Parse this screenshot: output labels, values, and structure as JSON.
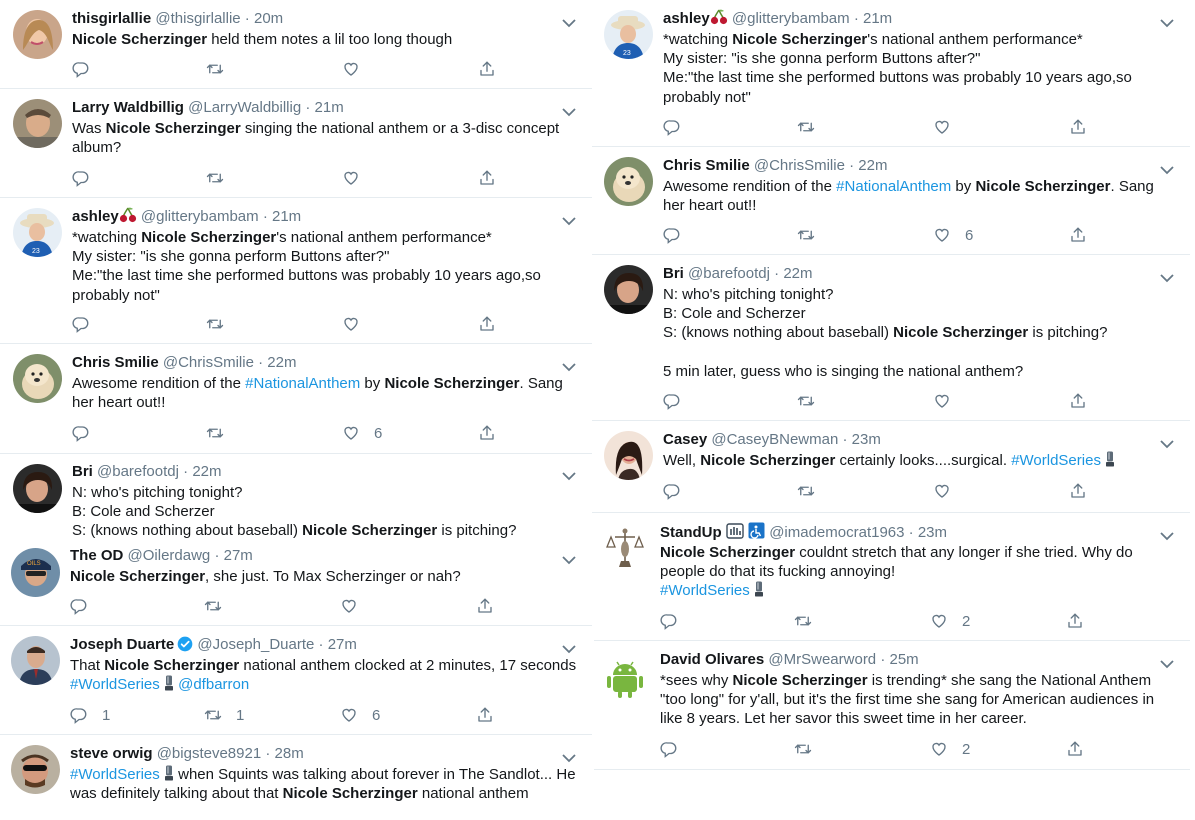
{
  "colors": {
    "text": "#14171a",
    "secondary": "#657786",
    "link": "#1b95e0",
    "divider": "#e6ecf0"
  },
  "left": [
    {
      "name": "thisgirlallie",
      "handle": "@thisgirlallie",
      "time": "20m",
      "lines": [
        [
          {
            "b": "Nicole Scherzinger"
          },
          {
            "t": " held them notes a lil too long though"
          }
        ]
      ],
      "replies": "",
      "retweets": "",
      "likes": ""
    },
    {
      "name": "Larry Waldbillig",
      "handle": "@LarryWaldbillig",
      "time": "21m",
      "lines": [
        [
          {
            "t": "Was "
          },
          {
            "b": "Nicole Scherzinger"
          },
          {
            "t": " singing the national anthem or a 3-disc concept"
          }
        ],
        [
          {
            "t": "album?"
          }
        ]
      ],
      "replies": "",
      "retweets": "",
      "likes": ""
    },
    {
      "name": "ashley",
      "handle": "@glitterybambam",
      "time": "21m",
      "lines": [
        [
          {
            "t": "*watching "
          },
          {
            "b": "Nicole Scherzinger"
          },
          {
            "t": "'s national anthem performance*"
          }
        ],
        [
          {
            "t": "My sister: \"is she gonna perform Buttons after?\""
          }
        ],
        [
          {
            "t": "Me:\"the last time she performed buttons was probably 10 years ago,so"
          }
        ],
        [
          {
            "t": "probably not\""
          }
        ]
      ],
      "replies": "",
      "retweets": "",
      "likes": ""
    },
    {
      "name": "Chris Smilie",
      "handle": "@ChrisSmilie",
      "time": "22m",
      "lines": [
        [
          {
            "t": "Awesome rendition of the "
          },
          {
            "h": "#NationalAnthem"
          },
          {
            "t": " by "
          },
          {
            "b": "Nicole Scherzinger"
          },
          {
            "t": ".  Sang"
          }
        ],
        [
          {
            "t": "her heart out!!"
          }
        ]
      ],
      "replies": "",
      "retweets": "",
      "likes": "6"
    },
    {
      "name": "Bri",
      "handle": "@barefootdj",
      "time": "22m",
      "lines": [
        [
          {
            "t": "N: who's pitching tonight?"
          }
        ],
        [
          {
            "t": "B: Cole and Scherzer"
          }
        ],
        [
          {
            "t": "S: (knows nothing about baseball) "
          },
          {
            "b": "Nicole Scherzinger"
          },
          {
            "t": " is pitching?"
          }
        ]
      ],
      "replies": "",
      "retweets": "",
      "likes": ""
    },
    {
      "name": "The OD",
      "handle": "@Oilerdawg",
      "time": "27m",
      "lines": [
        [
          {
            "b": "Nicole Scherzinger"
          },
          {
            "t": ", she just. To Max Scherzinger or nah?"
          }
        ]
      ],
      "replies": "",
      "retweets": "",
      "likes": ""
    },
    {
      "name": "Joseph Duarte",
      "handle": "@Joseph_Duarte",
      "time": "27m",
      "lines": [
        [
          {
            "t": "That "
          },
          {
            "b": "Nicole Scherzinger"
          },
          {
            "t": " national anthem clocked at 2 minutes, 17 seconds"
          }
        ],
        [
          {
            "h": "#WorldSeries"
          },
          {
            "t": " "
          },
          {
            "e": "trophy"
          },
          {
            "t": "  "
          },
          {
            "h": "@dfbarron"
          }
        ]
      ],
      "replies": "1",
      "retweets": "1",
      "likes": "6"
    },
    {
      "name": "steve orwig",
      "handle": "@bigsteve8921",
      "time": "28m",
      "lines": [
        [
          {
            "h": "#WorldSeries"
          },
          {
            "t": " "
          },
          {
            "e": "trophy"
          },
          {
            "t": " when Squints was talking about forever in The Sandlot... He"
          }
        ],
        [
          {
            "t": "was definitely talking about that "
          },
          {
            "b": "Nicole Scherzinger"
          },
          {
            "t": " national anthem"
          }
        ]
      ],
      "replies": "",
      "retweets": "",
      "likes": ""
    }
  ],
  "right": [
    {
      "name": "ashley",
      "handle": "@glitterybambam",
      "time": "21m",
      "lines": [
        [
          {
            "t": "*watching "
          },
          {
            "b": "Nicole Scherzinger"
          },
          {
            "t": "'s national anthem performance*"
          }
        ],
        [
          {
            "t": "My sister: \"is she gonna perform Buttons after?\""
          }
        ],
        [
          {
            "t": "Me:\"the last time she performed buttons was probably 10 years ago,so"
          }
        ],
        [
          {
            "t": "probably not\""
          }
        ]
      ],
      "replies": "",
      "retweets": "",
      "likes": ""
    },
    {
      "name": "Chris Smilie",
      "handle": "@ChrisSmilie",
      "time": "22m",
      "lines": [
        [
          {
            "t": "Awesome rendition of the "
          },
          {
            "h": "#NationalAnthem"
          },
          {
            "t": " by "
          },
          {
            "b": "Nicole Scherzinger"
          },
          {
            "t": ".  Sang"
          }
        ],
        [
          {
            "t": "her heart out!!"
          }
        ]
      ],
      "replies": "",
      "retweets": "",
      "likes": "6"
    },
    {
      "name": "Bri",
      "handle": "@barefootdj",
      "time": "22m",
      "lines": [
        [
          {
            "t": "N: who's pitching tonight?"
          }
        ],
        [
          {
            "t": "B: Cole and Scherzer"
          }
        ],
        [
          {
            "t": "S: (knows nothing about baseball) "
          },
          {
            "b": "Nicole Scherzinger"
          },
          {
            "t": " is pitching?"
          }
        ],
        [
          {
            "t": ""
          }
        ],
        [
          {
            "t": "5 min later, guess who is singing the national anthem?"
          }
        ]
      ],
      "replies": "",
      "retweets": "",
      "likes": ""
    },
    {
      "name": "Casey",
      "handle": "@CaseyBNewman",
      "time": "23m",
      "lines": [
        [
          {
            "t": "Well, "
          },
          {
            "b": "Nicole Scherzinger"
          },
          {
            "t": " certainly looks....surgical. "
          },
          {
            "h": "#WorldSeries"
          },
          {
            "t": " "
          },
          {
            "e": "trophy"
          }
        ]
      ],
      "replies": "",
      "retweets": "",
      "likes": ""
    },
    {
      "name": "StandUp",
      "handle": "@imademocrat1963",
      "time": "23m",
      "lines": [
        [
          {
            "b": "Nicole Scherzinger"
          },
          {
            "t": " couldnt stretch that any longer if she tried.  Why do"
          }
        ],
        [
          {
            "t": "people do that its fucking annoying!"
          }
        ],
        [
          {
            "h": "#WorldSeries"
          },
          {
            "t": " "
          },
          {
            "e": "trophy"
          }
        ]
      ],
      "replies": "",
      "retweets": "",
      "likes": "2"
    },
    {
      "name": "David Olivares",
      "handle": "@MrSwearword",
      "time": "25m",
      "lines": [
        [
          {
            "t": "*sees why "
          },
          {
            "b": "Nicole Scherzinger"
          },
          {
            "t": " is trending* she sang the National Anthem"
          }
        ],
        [
          {
            "t": "\"too long\" for y'all, but it's the first time she sang for American audiences in"
          }
        ],
        [
          {
            "t": "like 8 years. Let her savor this sweet time in her career."
          }
        ]
      ],
      "replies": "",
      "retweets": "",
      "likes": "2"
    }
  ]
}
